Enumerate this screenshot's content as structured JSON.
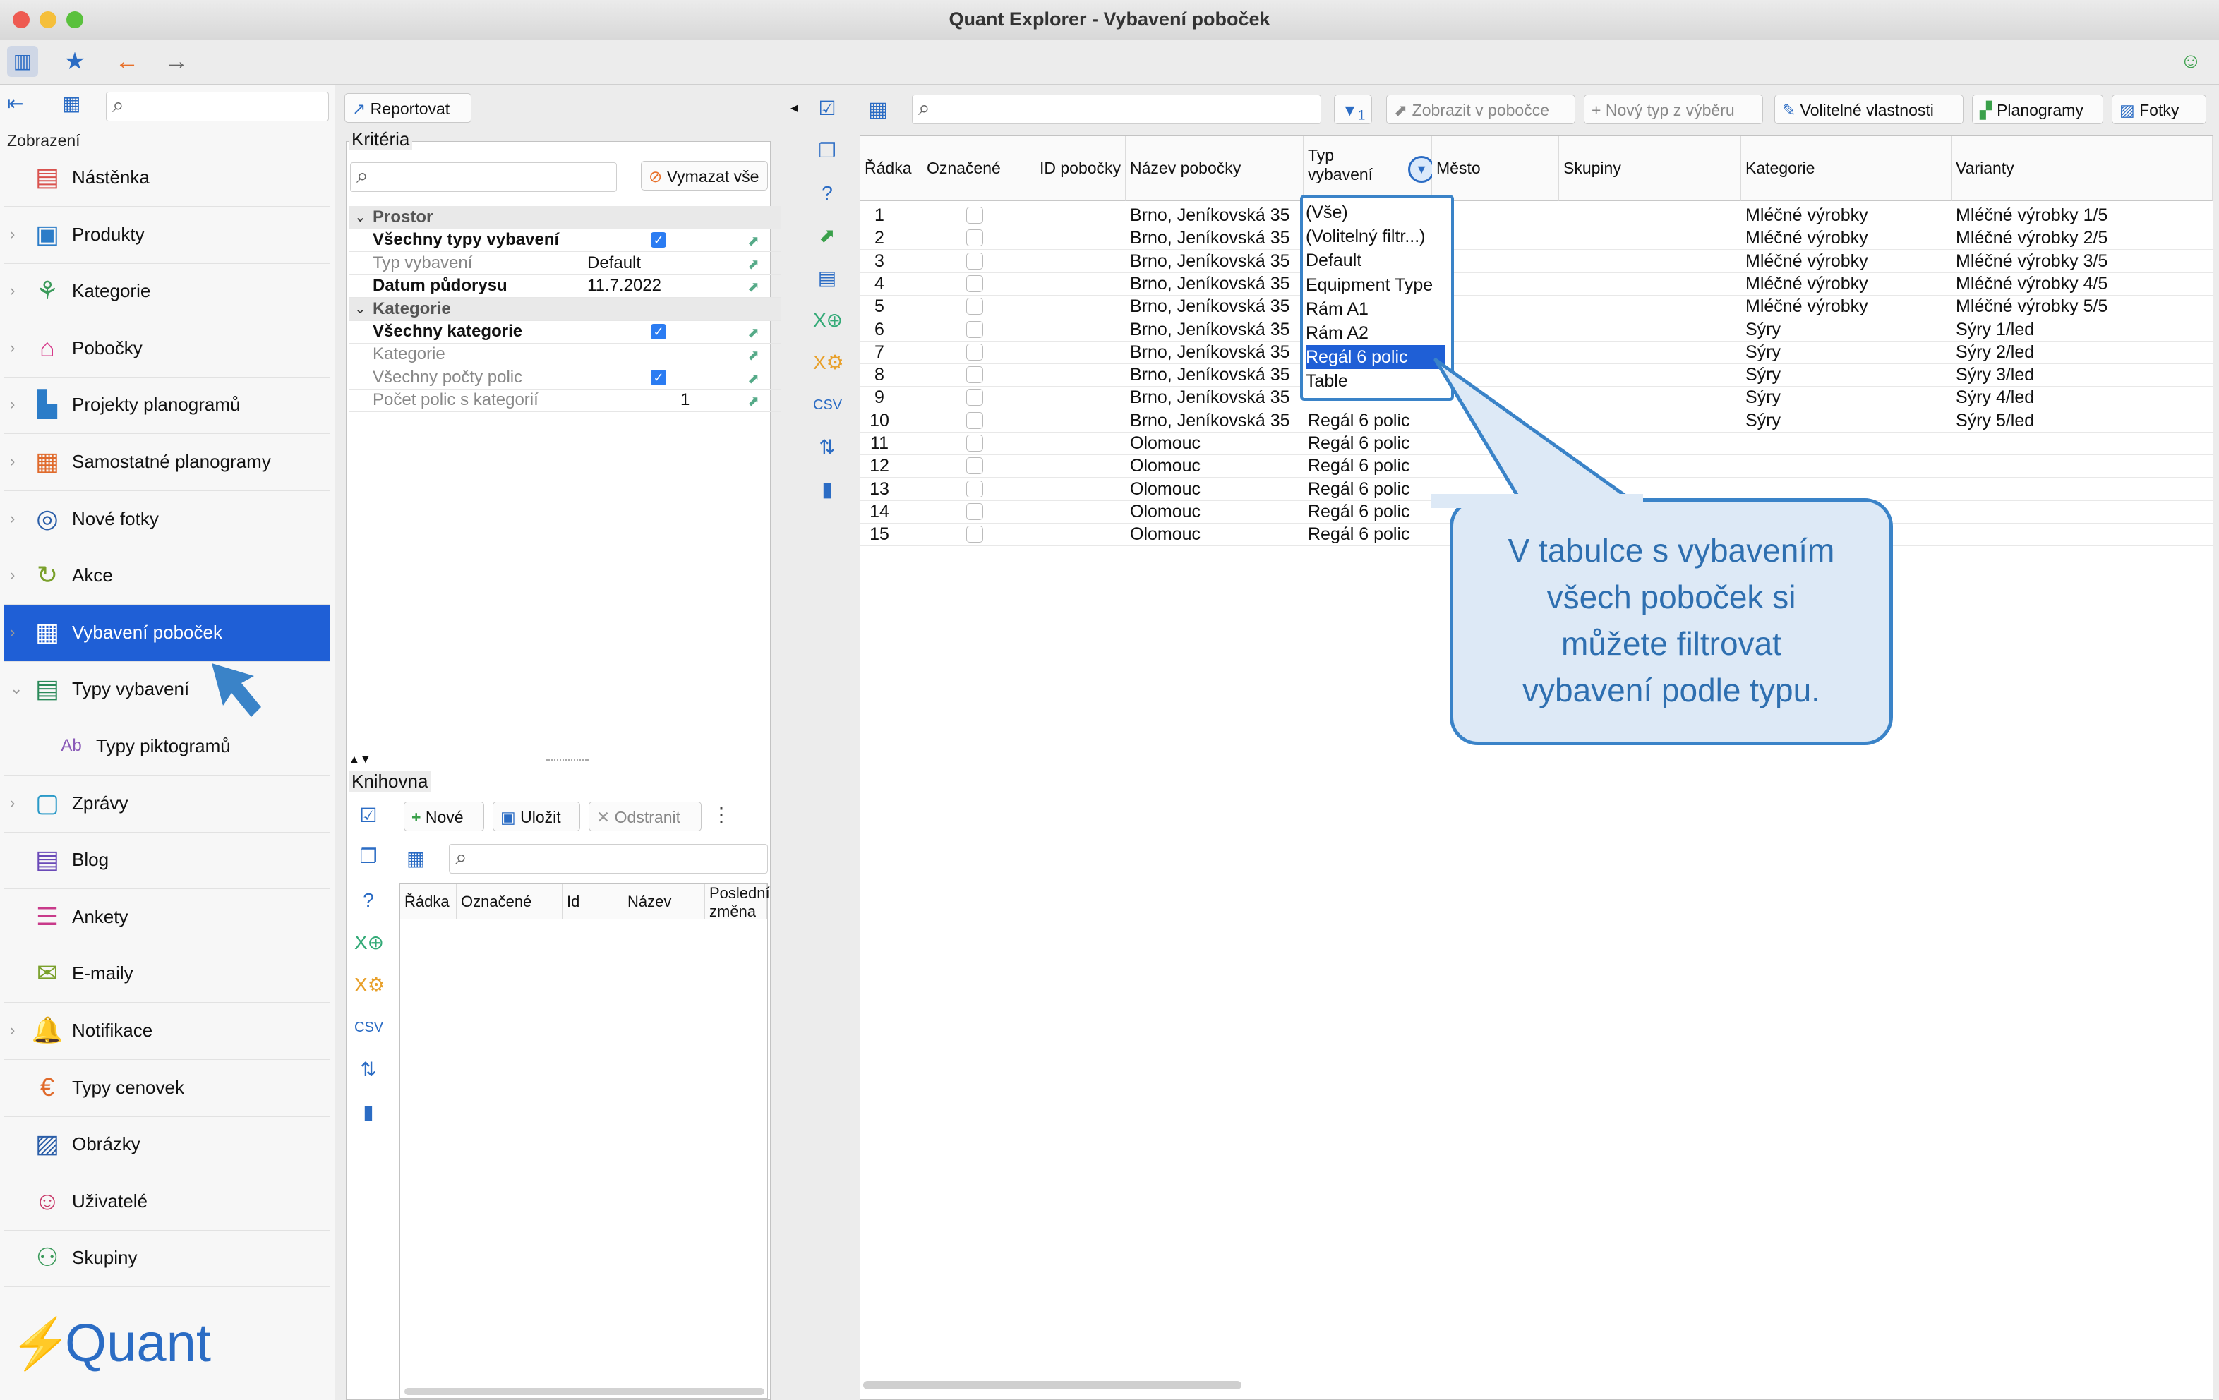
{
  "window": {
    "title": "Quant Explorer - Vybavení poboček"
  },
  "sidebar": {
    "section_label": "Zobrazení",
    "search_placeholder": "",
    "items": [
      {
        "label": "Nástěnka",
        "icon": "dashboard-icon",
        "color": "#d9534f"
      },
      {
        "label": "Produkty",
        "icon": "product-icon",
        "color": "#2b7cc8"
      },
      {
        "label": "Kategorie",
        "icon": "category-tree-icon",
        "color": "#3a9a5a"
      },
      {
        "label": "Pobočky",
        "icon": "store-icon",
        "color": "#d63a8a"
      },
      {
        "label": "Projekty planogramů",
        "icon": "planogram-project-icon",
        "color": "#2b7cc8"
      },
      {
        "label": "Samostatné planogramy",
        "icon": "planogram-icon",
        "color": "#e06a2b"
      },
      {
        "label": "Nové fotky",
        "icon": "camera-icon",
        "color": "#2b5ea8"
      },
      {
        "label": "Akce",
        "icon": "promo-icon",
        "color": "#7aa02b"
      },
      {
        "label": "Vybavení poboček",
        "icon": "store-equipment-icon",
        "color": "#ffffff"
      },
      {
        "label": "Typy vybavení",
        "icon": "equipment-types-icon",
        "color": "#2b8a5a"
      },
      {
        "label": "Typy piktogramů",
        "icon": "pictogram-icon",
        "color": "#8a5ab8"
      },
      {
        "label": "Zprávy",
        "icon": "message-icon",
        "color": "#2b9ac8"
      },
      {
        "label": "Blog",
        "icon": "blog-icon",
        "color": "#6a4ab8"
      },
      {
        "label": "Ankety",
        "icon": "survey-icon",
        "color": "#c83a8a"
      },
      {
        "label": "E-maily",
        "icon": "email-icon",
        "color": "#7aa02b"
      },
      {
        "label": "Notifikace",
        "icon": "bell-icon",
        "color": "#2b5ea8"
      },
      {
        "label": "Typy cenovek",
        "icon": "price-tag-icon",
        "color": "#e06a2b"
      },
      {
        "label": "Obrázky",
        "icon": "image-icon",
        "color": "#2b5ea8"
      },
      {
        "label": "Uživatelé",
        "icon": "user-icon",
        "color": "#c83a6a"
      },
      {
        "label": "Skupiny",
        "icon": "group-icon",
        "color": "#3a9a5a"
      }
    ],
    "selected_index": 8,
    "logo_text": "Quant"
  },
  "criteria": {
    "report_button": "Reportovat",
    "title": "Kritéria",
    "clear_button": "Vymazat vše",
    "rows": [
      {
        "type": "section",
        "label": "Prostor"
      },
      {
        "type": "check",
        "label": "Všechny typy vybavení",
        "bold": true,
        "checked": true
      },
      {
        "type": "value",
        "label": "Typ vybavení",
        "value": "Default",
        "muted": true
      },
      {
        "type": "value",
        "label": "Datum půdorysu",
        "value": "11.7.2022",
        "bold": true
      },
      {
        "type": "section",
        "label": "Kategorie"
      },
      {
        "type": "check",
        "label": "Všechny kategorie",
        "bold": true,
        "checked": true
      },
      {
        "type": "value",
        "label": "Kategorie",
        "value": "",
        "muted": true
      },
      {
        "type": "check",
        "label": "Všechny počty polic",
        "muted": true,
        "checked": true
      },
      {
        "type": "value",
        "label": "Počet polic s kategorií",
        "value": "1",
        "muted": true
      }
    ]
  },
  "library": {
    "title": "Knihovna",
    "new_button": "Nové",
    "save_button": "Uložit",
    "delete_button": "Odstranit",
    "columns": [
      "Řádka",
      "Označené",
      "Id",
      "Název",
      "Poslední změna"
    ]
  },
  "main_toolbar": {
    "show_in_store": "Zobrazit v pobočce",
    "new_type": "Nový typ z výběru",
    "optional_props": "Volitelné vlastnosti",
    "planograms": "Planogramy",
    "photos": "Fotky",
    "filter_count": "1"
  },
  "table": {
    "columns": [
      "Řádka",
      "Označené",
      "ID pobočky",
      "Název pobočky",
      "Typ vybavení",
      "Město",
      "Skupiny",
      "Kategorie",
      "Varianty"
    ],
    "rows": [
      {
        "n": "1",
        "name": "Brno, Jeníkovská 35",
        "type": "",
        "cat": "Mléčné výrobky",
        "var": "Mléčné výrobky 1/5"
      },
      {
        "n": "2",
        "name": "Brno, Jeníkovská 35",
        "type": "",
        "cat": "Mléčné výrobky",
        "var": "Mléčné výrobky 2/5"
      },
      {
        "n": "3",
        "name": "Brno, Jeníkovská 35",
        "type": "",
        "cat": "Mléčné výrobky",
        "var": "Mléčné výrobky 3/5"
      },
      {
        "n": "4",
        "name": "Brno, Jeníkovská 35",
        "type": "",
        "cat": "Mléčné výrobky",
        "var": "Mléčné výrobky 4/5"
      },
      {
        "n": "5",
        "name": "Brno, Jeníkovská 35",
        "type": "",
        "cat": "Mléčné výrobky",
        "var": "Mléčné výrobky 5/5"
      },
      {
        "n": "6",
        "name": "Brno, Jeníkovská 35",
        "type": "",
        "cat": "Sýry",
        "var": "Sýry 1/led"
      },
      {
        "n": "7",
        "name": "Brno, Jeníkovská 35",
        "type": "",
        "cat": "Sýry",
        "var": "Sýry 2/led"
      },
      {
        "n": "8",
        "name": "Brno, Jeníkovská 35",
        "type": "",
        "cat": "Sýry",
        "var": "Sýry 3/led"
      },
      {
        "n": "9",
        "name": "Brno, Jeníkovská 35",
        "type": "",
        "cat": "Sýry",
        "var": "Sýry 4/led"
      },
      {
        "n": "10",
        "name": "Brno, Jeníkovská 35",
        "type": "Regál 6 polic",
        "cat": "Sýry",
        "var": "Sýry 5/led"
      },
      {
        "n": "11",
        "name": "Olomouc",
        "type": "Regál 6 polic",
        "cat": "",
        "var": ""
      },
      {
        "n": "12",
        "name": "Olomouc",
        "type": "Regál 6 polic",
        "cat": "",
        "var": ""
      },
      {
        "n": "13",
        "name": "Olomouc",
        "type": "Regál 6 polic",
        "cat": "",
        "var": ""
      },
      {
        "n": "14",
        "name": "Olomouc",
        "type": "Regál 6 polic",
        "cat": "",
        "var": ""
      },
      {
        "n": "15",
        "name": "Olomouc",
        "type": "Regál 6 polic",
        "cat": "",
        "var": ""
      }
    ]
  },
  "dropdown": {
    "options": [
      "(Vše)",
      "(Volitelný filtr...)",
      "Default",
      "Equipment Type",
      "Rám A1",
      "Rám A2",
      "Regál 6 polic",
      "Table"
    ],
    "selected_index": 6
  },
  "callout": {
    "text_lines": [
      "V tabulce s vybavením",
      "všech poboček si",
      "můžete filtrovat",
      "vybavení podle typu."
    ]
  },
  "colors": {
    "selection": "#1f5fd6",
    "callout_border": "#3a83c8",
    "callout_text": "#2e6fb0"
  }
}
